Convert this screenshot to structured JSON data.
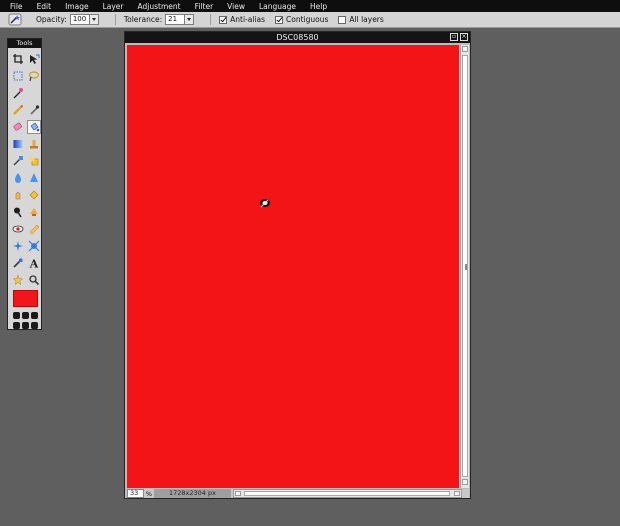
{
  "menu": [
    "File",
    "Edit",
    "Image",
    "Layer",
    "Adjustment",
    "Filter",
    "View",
    "Language",
    "Help"
  ],
  "options": {
    "tool_icon": "magic-wand-icon",
    "opacity_label": "Opacity:",
    "opacity_value": "100",
    "tolerance_label": "Tolerance:",
    "tolerance_value": "21",
    "anti_alias_label": "Anti-alias",
    "anti_alias_checked": true,
    "contiguous_label": "Contiguous",
    "contiguous_checked": true,
    "all_layers_label": "All layers",
    "all_layers_checked": false
  },
  "tools_panel": {
    "title": "Tools",
    "tools": [
      "crop-icon",
      "move-icon",
      "marquee-icon",
      "lasso-icon",
      "magic-wand-icon",
      "blank",
      "pencil-icon",
      "brush-icon",
      "eraser-icon",
      "fill-bucket-icon",
      "gradient-icon",
      "clone-stamp-icon",
      "color-replace-icon",
      "drawing-icon",
      "blur-icon",
      "sharpen-icon",
      "smudge-icon",
      "sponge-icon",
      "dodge-icon",
      "burn-icon",
      "red-eye-icon",
      "spot-heal-icon",
      "bloat-icon",
      "pinch-icon",
      "color-picker-icon",
      "type-icon",
      "hand-icon",
      "zoom-icon"
    ],
    "active_tool": "magic-wand-icon",
    "foreground_color": "#f0161b"
  },
  "image_window": {
    "title": "DSC08580",
    "canvas_color": "#f31418",
    "zoom_value": "33",
    "zoom_unit": "%",
    "size_label": "1728x2304 px"
  }
}
